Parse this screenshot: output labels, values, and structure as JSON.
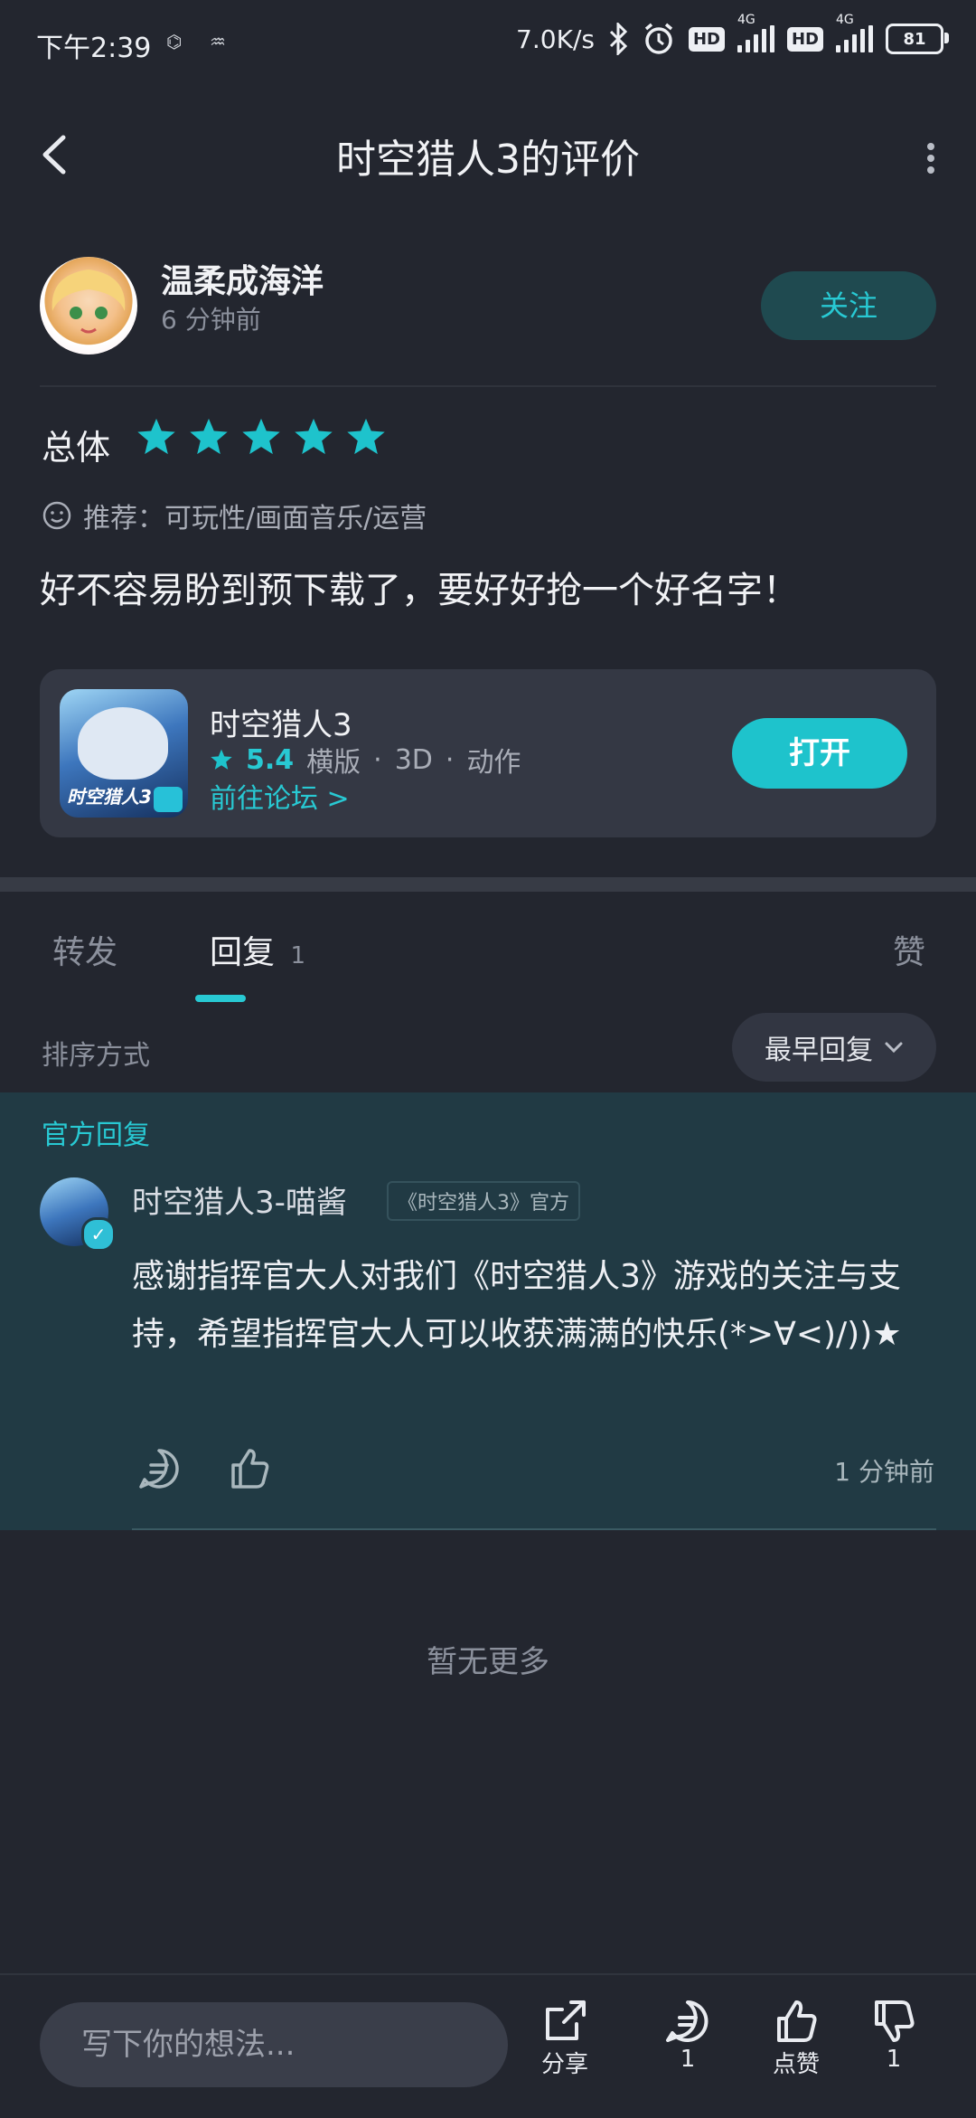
{
  "status": {
    "time": "下午2:39",
    "net_speed": "7.0K/s",
    "battery": "81",
    "hd1": "HD",
    "hd2": "HD",
    "g1": "4G",
    "g2": "4G"
  },
  "header": {
    "title": "时空猎人3的评价"
  },
  "author": {
    "name": "温柔成海洋",
    "time": "6 分钟前",
    "follow_label": "关注"
  },
  "rating": {
    "label": "总体",
    "stars": 5
  },
  "recommend": {
    "text": "推荐：可玩性/画面音乐/运营"
  },
  "review": {
    "text": "好不容易盼到预下载了，要好好抢一个好名字！"
  },
  "game": {
    "name": "时空猎人3",
    "score": "5.4",
    "tags": [
      "横版",
      "3D",
      "动作"
    ],
    "forum_label": "前往论坛 >",
    "open_label": "打开",
    "logo_text": "时空猎人3"
  },
  "tabs": {
    "forward": "转发",
    "reply": "回复",
    "reply_count": "1",
    "like": "赞"
  },
  "sort": {
    "label": "排序方式",
    "value": "最早回复"
  },
  "official": {
    "section_label": "官方回复",
    "name": "时空猎人3-喵酱",
    "tag": "《时空猎人3》官方",
    "text": "感谢指挥官大人对我们《时空猎人3》游戏的关注与支持，希望指挥官大人可以收获满满的快乐(*>∀<)/))★",
    "time": "1 分钟前"
  },
  "footer": {
    "no_more": "暂无更多"
  },
  "bottom": {
    "placeholder": "写下你的想法...",
    "share": "分享",
    "comments": "1",
    "like": "点赞",
    "dislike": "1"
  },
  "colors": {
    "accent": "#1ec3cc",
    "background": "#23262f",
    "official_bg": "#213a44"
  }
}
